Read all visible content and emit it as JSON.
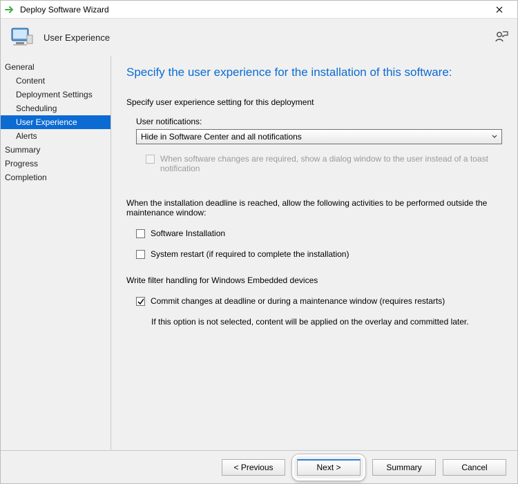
{
  "window": {
    "title": "Deploy Software Wizard"
  },
  "header": {
    "label": "User Experience"
  },
  "sidebar": {
    "items": [
      {
        "label": "General",
        "top": true
      },
      {
        "label": "Content",
        "top": false
      },
      {
        "label": "Deployment Settings",
        "top": false
      },
      {
        "label": "Scheduling",
        "top": false
      },
      {
        "label": "User Experience",
        "top": false,
        "selected": true
      },
      {
        "label": "Alerts",
        "top": false
      },
      {
        "label": "Summary",
        "top": true
      },
      {
        "label": "Progress",
        "top": true
      },
      {
        "label": "Completion",
        "top": true
      }
    ]
  },
  "content": {
    "heading": "Specify the user experience for the installation of this software:",
    "section1_label": "Specify user experience setting for this deployment",
    "notifications_label": "User notifications:",
    "notifications_value": "Hide in Software Center and all notifications",
    "dialog_checkbox": "When software changes are required, show a dialog window to the user instead of a toast notification",
    "deadline_text": "When the installation deadline is reached, allow the following activities to be performed outside the maintenance window:",
    "cb_install": "Software Installation",
    "cb_restart": "System restart  (if required to complete the installation)",
    "embedded_label": "Write filter handling for Windows Embedded devices",
    "cb_commit": "Commit changes at deadline or during a maintenance window (requires restarts)",
    "commit_note": "If this option is not selected, content will be applied on the overlay and committed later."
  },
  "footer": {
    "previous": "< Previous",
    "next": "Next >",
    "summary": "Summary",
    "cancel": "Cancel"
  }
}
